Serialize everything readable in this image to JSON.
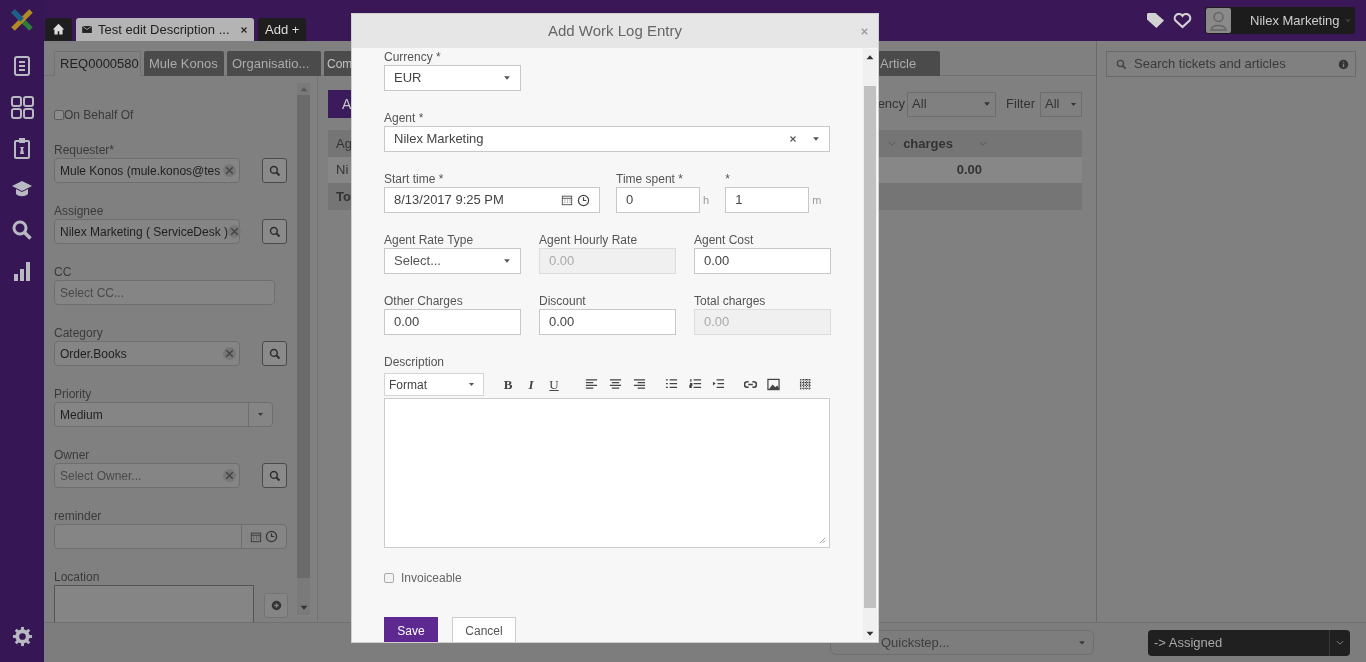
{
  "app_header": {
    "tabs": [
      {
        "kind": "home",
        "selected": false
      },
      {
        "kind": "ticket",
        "label": "Test edit Description ...",
        "selected": true
      },
      {
        "kind": "add",
        "label": "Add +",
        "selected": false
      }
    ],
    "user": "Nilex Marketing"
  },
  "ticket_tabs": [
    {
      "label": "REQ0000580",
      "selected": true
    },
    {
      "label": "Mule Konos",
      "selected": false
    },
    {
      "label": "Organisatio...",
      "selected": false
    },
    {
      "label": "Com",
      "selected": false
    },
    {
      "label": "Article",
      "selected": false
    }
  ],
  "ticket_form": {
    "on_behalf_of": {
      "label": "On Behalf Of",
      "checked": false
    },
    "fields": [
      {
        "kind": "lookup",
        "label": "Requester*",
        "value": "Mule Konos (mule.konos@tes"
      },
      {
        "kind": "lookup",
        "label": "Assignee",
        "value": "Nilex Marketing ( ServiceDesk )"
      },
      {
        "kind": "multiselect",
        "label": "CC",
        "placeholder": "Select CC..."
      },
      {
        "kind": "lookup",
        "label": "Category",
        "value": "Order.Books"
      },
      {
        "kind": "select",
        "label": "Priority",
        "value": "Medium"
      },
      {
        "kind": "lookup",
        "label": "Owner",
        "placeholder": "Select Owner..."
      },
      {
        "kind": "datetime",
        "label": "reminder"
      },
      {
        "kind": "location",
        "label": "Location"
      }
    ]
  },
  "work_log": {
    "add_button": "A",
    "currency_label": "ency",
    "currency_value": "All",
    "filter_label": "Filter",
    "filter_value": "All",
    "table": {
      "columns": [
        "Ag",
        "charges"
      ],
      "rows": [
        [
          "Ni",
          "0.00"
        ]
      ],
      "total_label": "To"
    }
  },
  "search": {
    "placeholder": "Search tickets and articles"
  },
  "bottom_bar": {
    "quickstep_placeholder": "Quickstep...",
    "status": "-> Assigned"
  },
  "dialog": {
    "title": "Add Work Log Entry",
    "rows": [
      {
        "fields": [
          {
            "kind": "select",
            "label": "Currency *",
            "value": "EUR",
            "disabled": false
          }
        ]
      },
      {
        "fields": [
          {
            "kind": "combo",
            "label": "Agent *",
            "value": "Nilex Marketing",
            "disabled": false
          }
        ]
      },
      {
        "fields": [
          {
            "kind": "datetime",
            "label": "Start time *",
            "value": "8/13/2017 9:25 PM",
            "disabled": false
          },
          {
            "kind": "duration",
            "label": "Time spent *",
            "value": "0",
            "unit": "h",
            "disabled": false
          },
          {
            "kind": "duration",
            "label": "*",
            "value": "1",
            "unit": "m",
            "disabled": false
          }
        ]
      },
      {
        "fields": [
          {
            "kind": "select",
            "label": "Agent Rate Type",
            "placeholder": "Select...",
            "disabled": false
          },
          {
            "kind": "text",
            "label": "Agent Hourly Rate",
            "value": "0.00",
            "disabled": true
          },
          {
            "kind": "text",
            "label": "Agent Cost",
            "value": "0.00",
            "disabled": false
          }
        ]
      },
      {
        "fields": [
          {
            "kind": "text",
            "label": "Other Charges",
            "value": "0.00",
            "disabled": false
          },
          {
            "kind": "text",
            "label": "Discount",
            "value": "0.00",
            "disabled": false
          },
          {
            "kind": "text",
            "label": "Total charges",
            "value": "0.00",
            "disabled": true
          }
        ]
      }
    ],
    "description": {
      "label": "Description",
      "format_label": "Format",
      "text_buttons": [
        {
          "label": "B",
          "kind": "bold"
        },
        {
          "label": "I",
          "kind": "italic"
        },
        {
          "label": "U",
          "kind": "underline"
        }
      ]
    },
    "invoiceable": {
      "label": "Invoiceable",
      "checked": false
    },
    "buttons": [
      {
        "label": "Save",
        "kind": "primary"
      },
      {
        "label": "Cancel",
        "kind": "secondary"
      }
    ]
  }
}
